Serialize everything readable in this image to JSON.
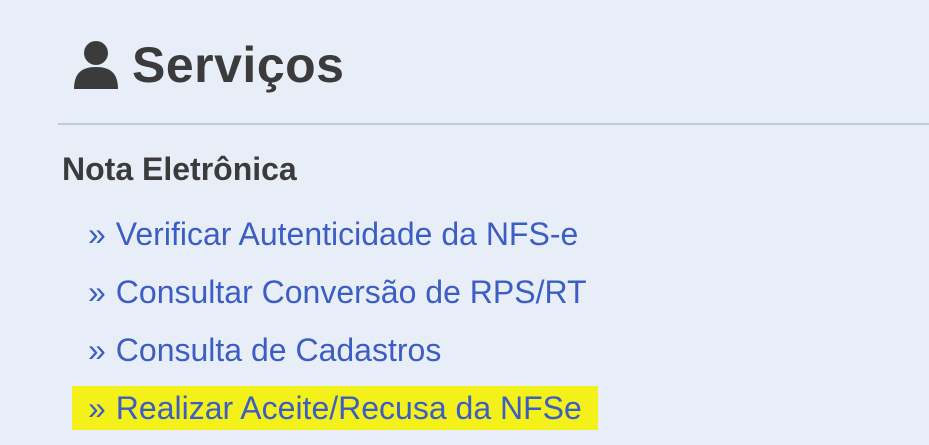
{
  "header": {
    "icon": "user-icon",
    "title": "Serviços"
  },
  "section": {
    "title": "Nota Eletrônica"
  },
  "menu": {
    "prefix": "»",
    "items": [
      {
        "label": "Verificar Autenticidade da NFS-e"
      },
      {
        "label": "Consultar Conversão de RPS/RT"
      },
      {
        "label": "Consulta de Cadastros"
      },
      {
        "label": "Realizar Aceite/Recusa da NFSe",
        "highlighted": true
      }
    ]
  },
  "colors": {
    "background": "#e8eef8",
    "heading": "#3b3b3b",
    "link": "#3c5ec4",
    "highlight": "#f3f01a",
    "divider": "#c2cbd6"
  }
}
